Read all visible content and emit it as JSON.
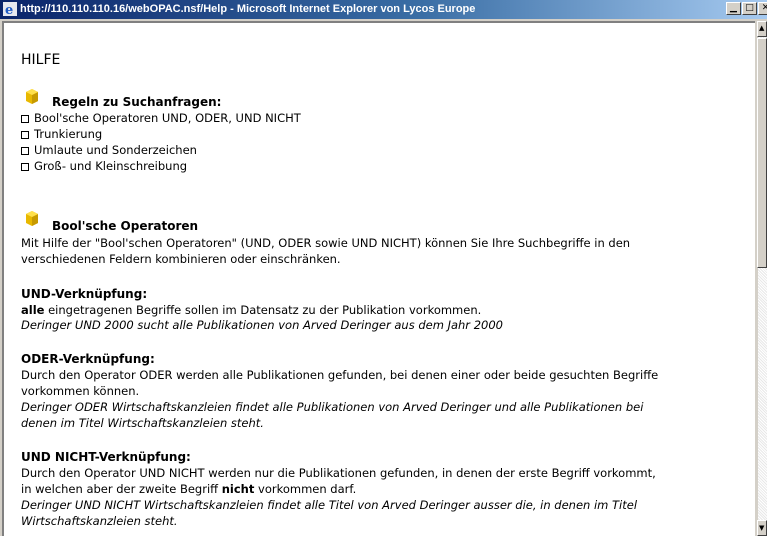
{
  "window": {
    "title": "http://110.110.110.16/webOPAC.nsf/Help - Microsoft Internet Explorer von Lycos Europe",
    "buttons": [
      "minimize",
      "maximize",
      "close"
    ]
  },
  "page": {
    "heading": "HILFE",
    "rules": {
      "title": "Regeln zu Suchanfragen:",
      "items": [
        "Bool'sche Operatoren UND, ODER, UND NICHT",
        "Trunkierung",
        "Umlaute und Sonderzeichen",
        "Groß- und Kleinschreibung"
      ]
    },
    "bool": {
      "title": "Bool'sche Operatoren",
      "intro1": "Mit Hilfe der \"Bool'schen Operatoren\" (UND, ODER sowie UND NICHT) können Sie Ihre Suchbegriffe in den",
      "intro2": "verschiedenen Feldern kombinieren oder einschränken."
    },
    "und": {
      "title": "UND-Verknüpfung:",
      "line1_bold": "alle",
      "line1_rest": " eingetragenen Begriffe sollen im Datensatz zu der Publikation vorkommen.",
      "example": "Deringer UND 2000 sucht alle Publikationen von Arved Deringer aus dem Jahr 2000"
    },
    "oder": {
      "title": "ODER-Verknüpfung:",
      "line1": "Durch den Operator ODER werden alle Publikationen gefunden, bei denen einer oder beide gesuchten Begriffe",
      "line2": "vorkommen können.",
      "example1": "Deringer ODER Wirtschaftskanzleien findet alle Publikationen von Arved Deringer und alle Publikationen bei",
      "example2": "denen im Titel Wirtschaftskanzleien steht."
    },
    "undnicht": {
      "title": "UND NICHT-Verknüpfung:",
      "line1": "Durch den Operator UND NICHT werden nur die Publikationen gefunden, in denen der erste Begriff vorkommt,",
      "line2_a": "in welchen aber der zweite Begriff ",
      "line2_bold": "nicht",
      "line2_b": " vorkommen darf.",
      "example1": "Deringer UND NICHT Wirtschaftskanzleien findet alle Titel von Arved Deringer ausser die, in denen im Titel",
      "example2": "Wirtschaftskanzleien steht."
    }
  },
  "colors": {
    "titlebar_start": "#0a246a",
    "titlebar_end": "#a6caf0",
    "bullet": "#e8b800"
  }
}
